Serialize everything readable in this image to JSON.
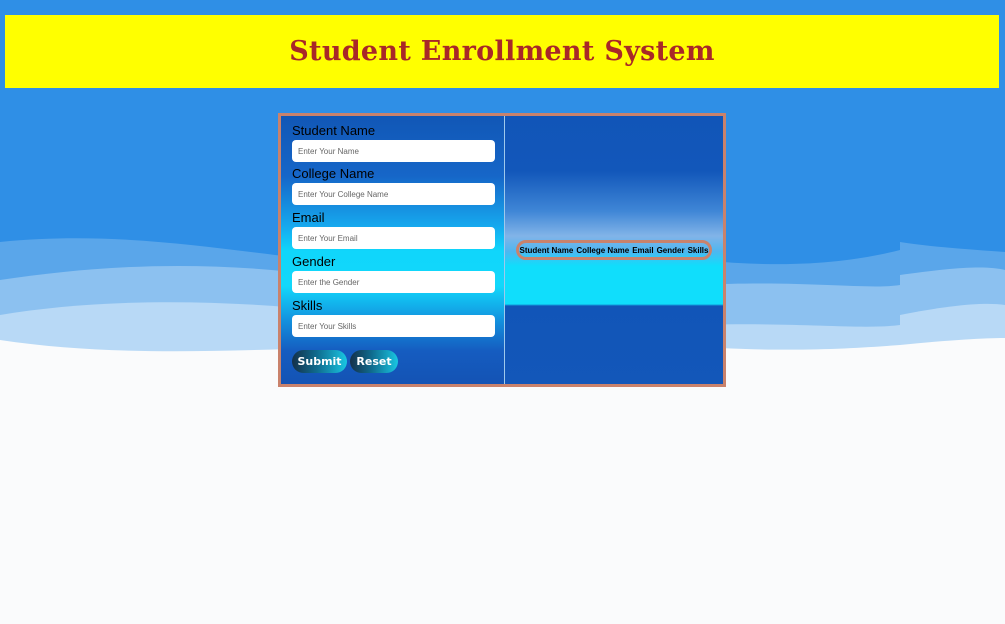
{
  "header": {
    "title": "Student Enrollment System"
  },
  "form": {
    "fields": [
      {
        "label": "Student Name",
        "placeholder": "Enter Your Name"
      },
      {
        "label": "College Name",
        "placeholder": "Enter Your College Name"
      },
      {
        "label": "Email",
        "placeholder": "Enter Your Email"
      },
      {
        "label": "Gender",
        "placeholder": "Enter the Gender"
      },
      {
        "label": "Skills",
        "placeholder": "Enter Your Skills"
      }
    ],
    "submit_label": "Submit",
    "reset_label": "Reset"
  },
  "output": {
    "columns": [
      "Student Name",
      "College Name",
      "Email",
      "Gender",
      "Skills"
    ]
  },
  "colors": {
    "header_bg": "#ffff00",
    "title": "#a82828",
    "sky": "#2f8fe6",
    "card_border": "#c9826c"
  }
}
